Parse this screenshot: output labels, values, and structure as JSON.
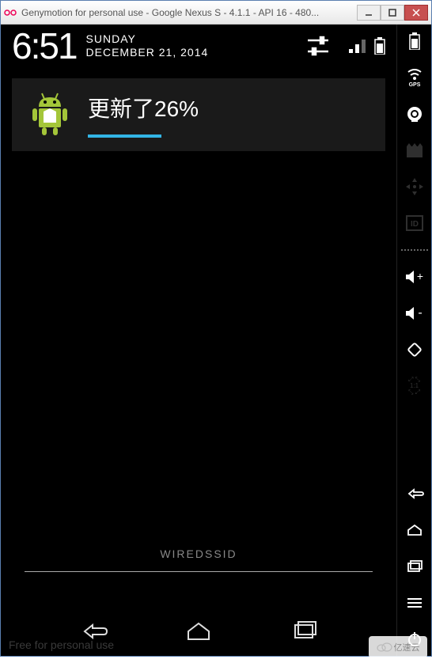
{
  "window": {
    "title": "Genymotion for personal use - Google Nexus S - 4.1.1 - API 16 - 480...",
    "controls": {
      "minimize": "min",
      "maximize": "max",
      "close": "close"
    }
  },
  "status": {
    "time": "6:51",
    "day": "SUNDAY",
    "date": "DECEMBER 21, 2014"
  },
  "notification": {
    "title": "更新了26%",
    "progress_percent": 26
  },
  "footer": {
    "ssid": "WIREDSSID",
    "watermark": "Free for personal use"
  },
  "nav": {
    "back": "back",
    "home": "home",
    "recent": "recent"
  },
  "sidebar": {
    "battery": "battery",
    "gps": "GPS",
    "camera": "camera",
    "clapper": "screencast",
    "dpad": "dpad",
    "id": "ID",
    "volup": "vol-up",
    "voldown": "vol-down",
    "rotate": "rotate",
    "scale": "1:1",
    "back": "back",
    "home": "home",
    "recent": "recent",
    "menu": "menu",
    "power": "power"
  },
  "logo": {
    "text": "亿速云"
  }
}
